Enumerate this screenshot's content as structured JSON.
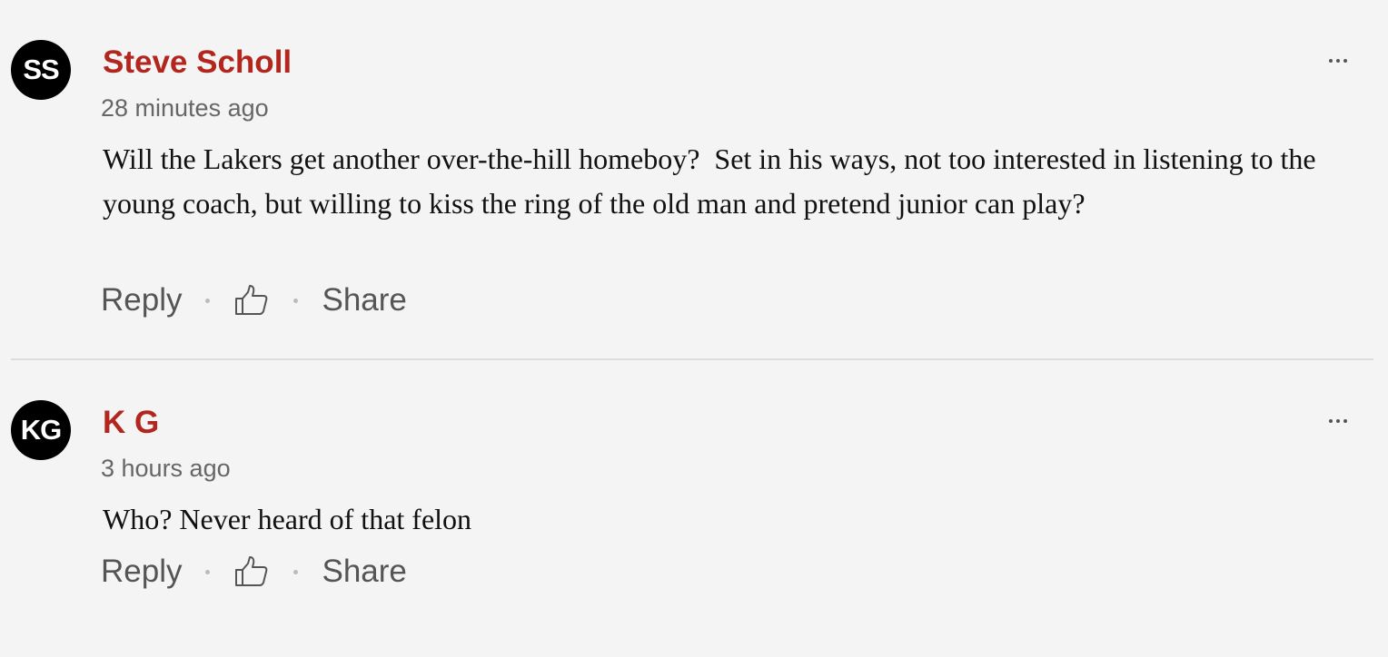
{
  "comments": [
    {
      "initials": "SS",
      "author": "Steve Scholl",
      "timestamp": "28 minutes ago",
      "text": "Will the Lakers get another over-the-hill homeboy?  Set in his ways, not too interested in listening to the young coach, but willing to kiss the ring of the old man and pretend junior can play?",
      "reply_label": "Reply",
      "share_label": "Share",
      "like_icon": "thumbs-up-icon",
      "more_icon": "more-options-icon"
    },
    {
      "initials": "KG",
      "author": "K G",
      "timestamp": "3 hours ago",
      "text": "Who? Never heard of that felon",
      "reply_label": "Reply",
      "share_label": "Share",
      "like_icon": "thumbs-up-icon",
      "more_icon": "more-options-icon"
    }
  ],
  "colors": {
    "background": "#f4f4f4",
    "author": "#b3261e",
    "avatar": "#000000",
    "divider": "#dcdcdc"
  }
}
